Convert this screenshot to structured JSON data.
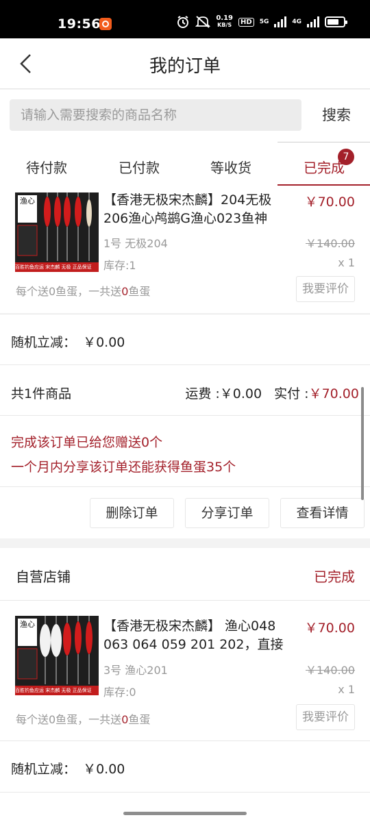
{
  "status_bar": {
    "time": "19:56",
    "net_speed_value": "0.19",
    "net_speed_unit": "KB/S",
    "hd_label": "HD",
    "net1": "5G",
    "net2": "4G",
    "icons": [
      "app-notification-icon",
      "alarm-icon",
      "mute-icon",
      "signal-icon",
      "battery-icon"
    ]
  },
  "header": {
    "title": "我的订单",
    "back_icon": "chevron-left-icon"
  },
  "search": {
    "placeholder": "请输入需要搜索的商品名称",
    "button": "搜索"
  },
  "tabs": [
    {
      "label": "待付款",
      "active": false
    },
    {
      "label": "已付款",
      "active": false
    },
    {
      "label": "等收货",
      "active": false
    },
    {
      "label": "已完成",
      "active": true,
      "badge": "7"
    }
  ],
  "orders": [
    {
      "product": {
        "title_line1": "【香港无极宋杰麟】204无极",
        "title_line2": "206渔心鸬鹚G渔心023鱼神",
        "price": "￥70.00",
        "original_price": "￥140.00",
        "spec": "1号 无极204",
        "quantity": "x 1",
        "stock": "库存:1",
        "gift_prefix": "每个送0鱼蛋，一共送",
        "gift_count": "0",
        "gift_suffix": "鱼蛋",
        "review_button": "我要评价",
        "thumb_logo": "渔心",
        "thumb_strip": "百胜钓鱼应运 宋杰麟 无极 正品保证"
      },
      "discount_label": "随机立减：",
      "discount_value": "￥0.00",
      "summary": {
        "count": "共1件商品",
        "shipping_label": "运费 :",
        "shipping_value": "￥0.00",
        "paid_label": "实付 :",
        "paid_value": "￥70.00"
      },
      "promo_line1": "完成该订单已给您赠送0个",
      "promo_line2": "一个月内分享该订单还能获得鱼蛋35个",
      "actions": [
        "删除订单",
        "分享订单",
        "查看详情"
      ]
    },
    {
      "shop": "自营店铺",
      "status": "已完成",
      "product": {
        "title_line1": "【香港无极宋杰麟】 渔心048",
        "title_line2": "063 064 059 201 202，直接",
        "price": "￥70.00",
        "original_price": "￥140.00",
        "spec": "3号 渔心201",
        "quantity": "x 1",
        "stock": "库存:0",
        "gift_prefix": "每个送0鱼蛋，一共送",
        "gift_count": "0",
        "gift_suffix": "鱼蛋",
        "review_button": "我要评价",
        "thumb_logo": "渔心",
        "thumb_strip": "百胜钓鱼应运 宋杰麟 无极 正品保证"
      },
      "discount_label": "随机立减：",
      "discount_value": "￥0.00"
    }
  ],
  "colors": {
    "accent": "#a3202a",
    "muted": "#999999",
    "background": "#f3f3f3"
  }
}
